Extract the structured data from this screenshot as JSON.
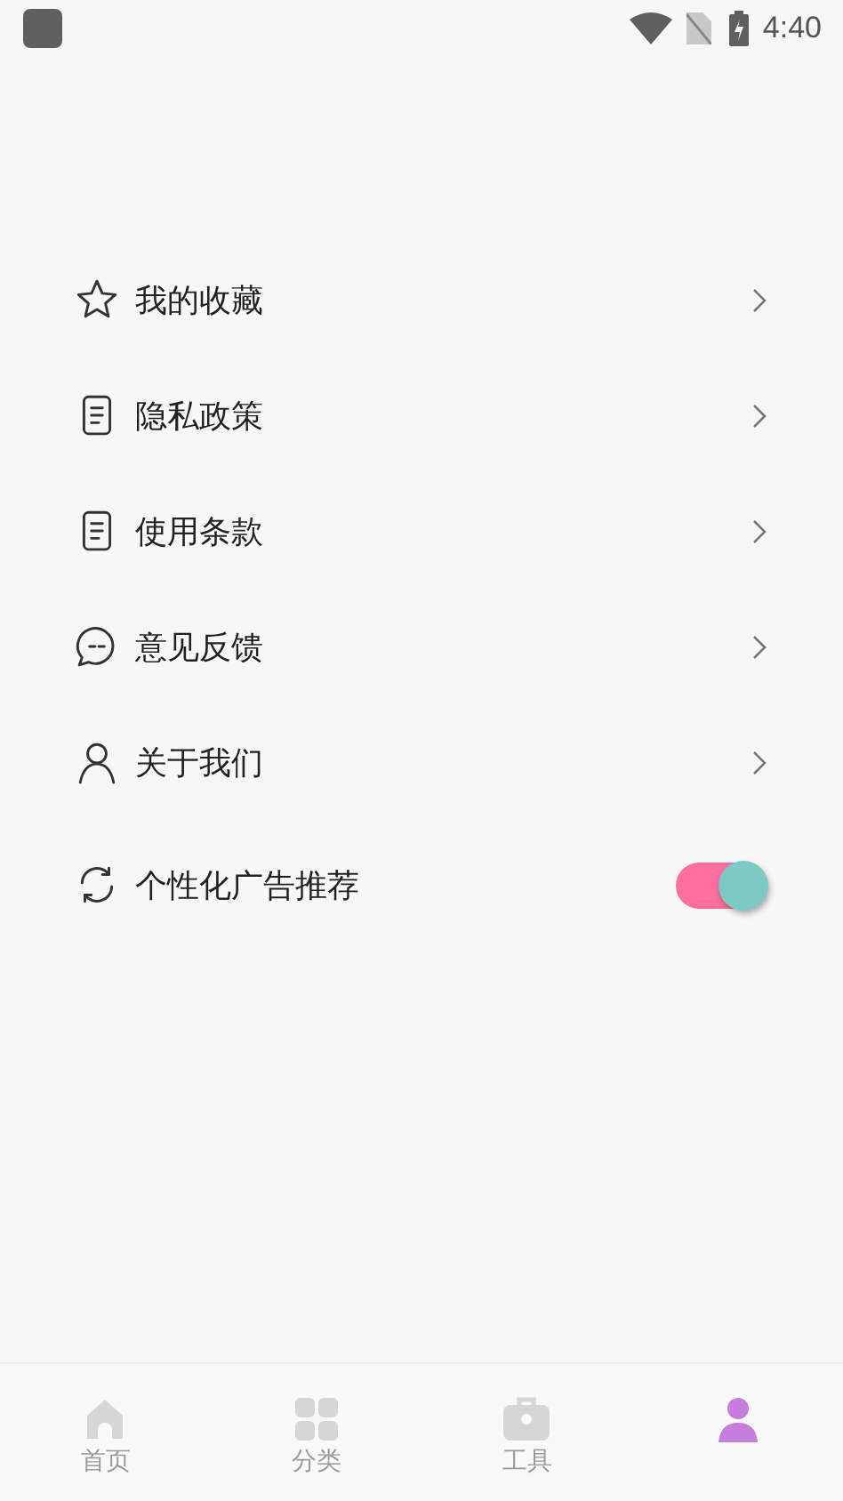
{
  "status_bar": {
    "time": "4:40"
  },
  "menu": [
    {
      "kind": "link",
      "label": "我的收藏"
    },
    {
      "kind": "link",
      "label": "隐私政策"
    },
    {
      "kind": "link",
      "label": "使用条款"
    },
    {
      "kind": "link",
      "label": "意见反馈"
    },
    {
      "kind": "link",
      "label": "关于我们"
    },
    {
      "kind": "toggle",
      "label": "个性化广告推荐",
      "on": true
    }
  ],
  "tabs": [
    {
      "label": "首页",
      "selected": false
    },
    {
      "label": "分类",
      "selected": false
    },
    {
      "label": "工具",
      "selected": false
    },
    {
      "selected": true
    }
  ]
}
